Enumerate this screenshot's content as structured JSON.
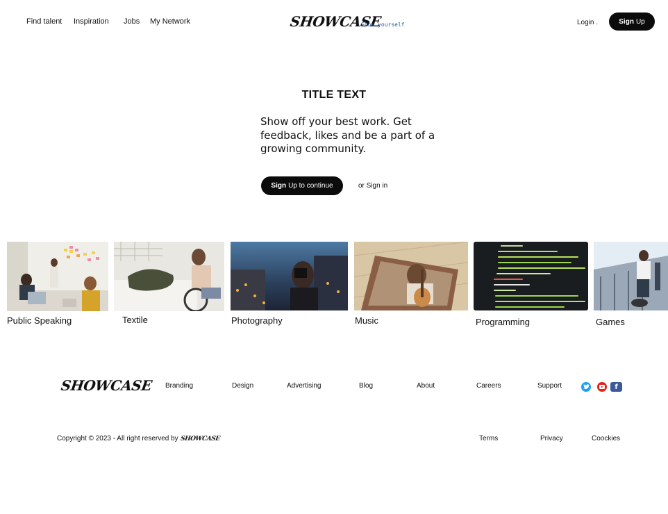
{
  "header": {
    "nav": [
      "Find talent",
      "Inspiration",
      "Jobs",
      "My Network"
    ],
    "logo": "SHOWCASE",
    "tagline": "Show yourself",
    "login": "Login .",
    "signup_bold": "Sign",
    "signup_rest": "Up"
  },
  "hero": {
    "title": "TITLE TEXT",
    "description": "Show off your best work. Get feedback, likes and be a part of a growing community.",
    "cta_bold": "Sign",
    "cta_rest": "Up to continue",
    "signin": "or Sign in"
  },
  "categories": [
    "Public Speaking",
    "Textile",
    "Photography",
    "Music",
    "Programming",
    "Games"
  ],
  "footer": {
    "logo": "SHOWCASE",
    "links": [
      "Branding",
      "Design",
      "Advertising",
      "Blog",
      "About",
      "Careers",
      "Support"
    ],
    "social": [
      "twitter-icon",
      "youtube-icon",
      "facebook-icon"
    ],
    "copyright": "Copyright © 2023 - All right reserved by",
    "copyright_logo": "SHOWCASE",
    "legal": [
      "Terms",
      "Privacy",
      "Coockies"
    ]
  },
  "colors": {
    "twitter": "#1da1f2",
    "youtube": "#e62117",
    "facebook": "#3b5998",
    "dark": "#0b0b0b"
  }
}
